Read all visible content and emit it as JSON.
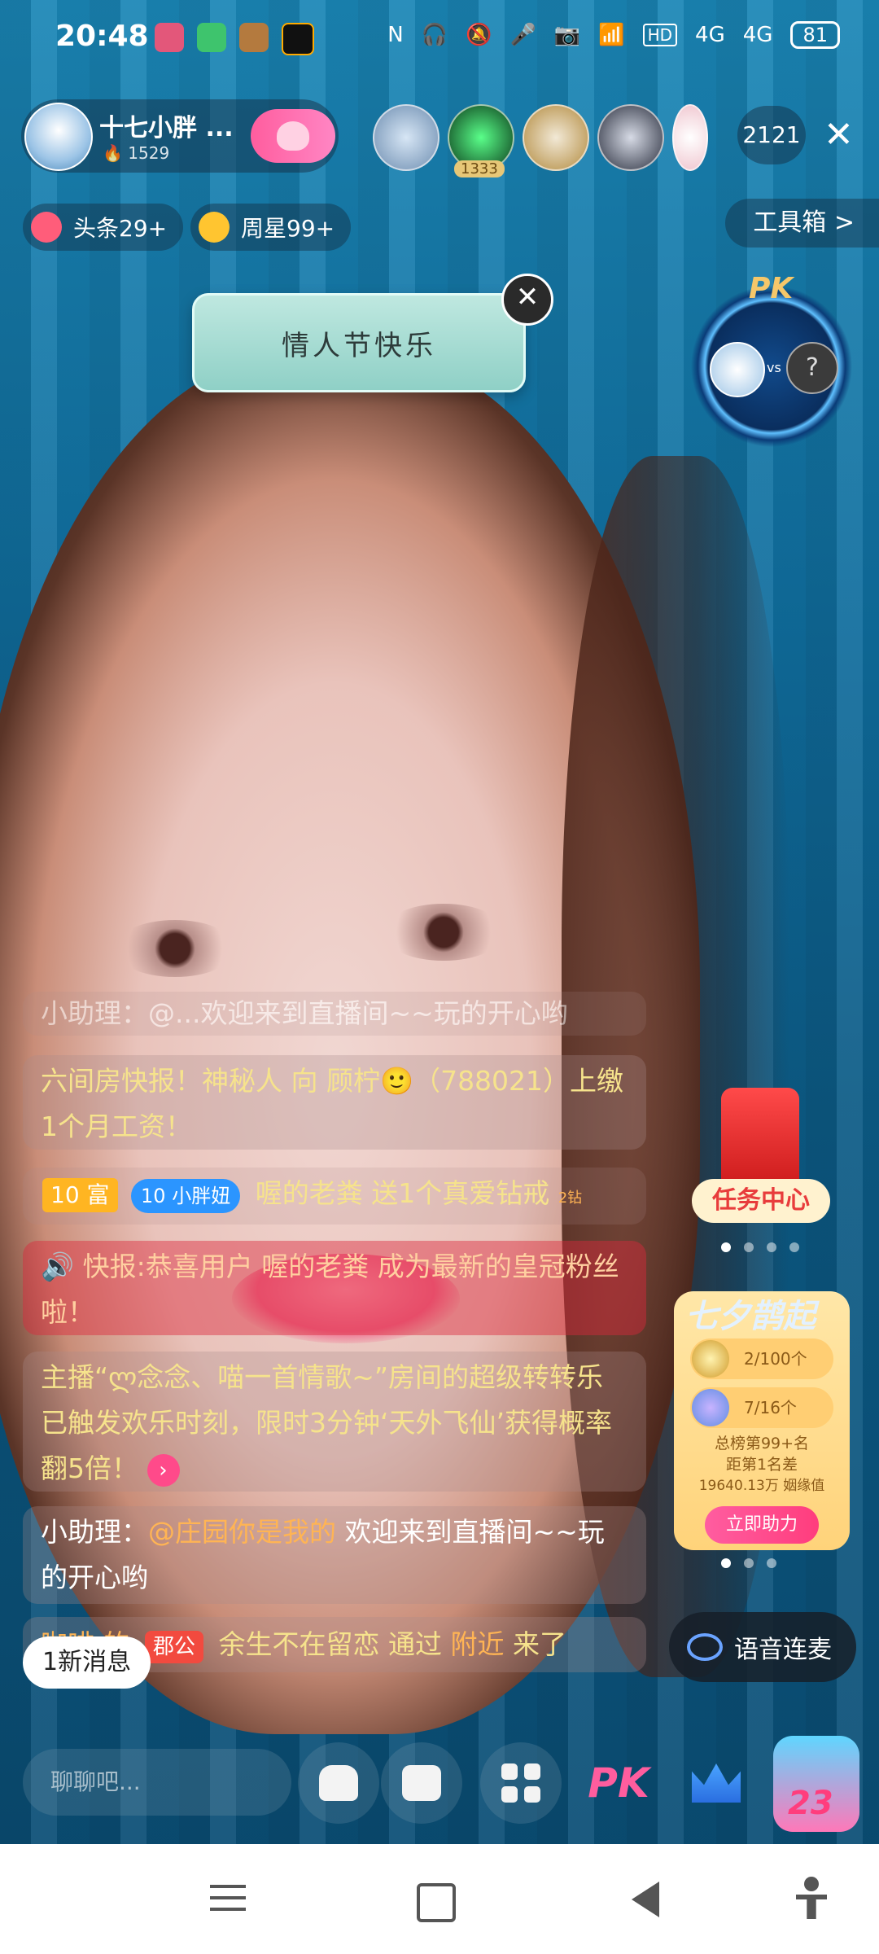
{
  "status_bar": {
    "time": "20:48",
    "network1": "4G",
    "network2": "4G",
    "hd_label": "HD",
    "battery": "81"
  },
  "anchor": {
    "name": "十七小胖 ...",
    "likes": "1529",
    "follow_icon": "heart-plus-icon"
  },
  "viewers": {
    "badge": "1333",
    "count": "2121"
  },
  "chips": {
    "headline": "头条29+",
    "weekly_star": "周星99+",
    "toolbox": "工具箱 >"
  },
  "banner": {
    "text": "情人节快乐"
  },
  "pk": {
    "label": "PK",
    "vs": "vs",
    "unknown": "?"
  },
  "chat": {
    "faded_line": "小助理：@...欢迎来到直播间~~玩的开心哟",
    "msg1": "六间房快报！神秘人 向 顾柠🙂（788021）上缴1个月工资！",
    "gift_level": "10 富",
    "gift_fan_level": "10",
    "gift_fan_name": "小胖妞",
    "gift_user": "喔的老粪",
    "gift_text": "送1个真爱钻戒",
    "gift_count": "2钻",
    "alert_prefix": "快报:",
    "alert_text": "恭喜用户 喔的老粪 成为最新的皇冠粉丝啦！",
    "host_line": "主播“ლ念念、喵一首情歌~”房间的超级转转乐已触发欢乐时刻，限时3分钟‘天外飞仙’获得概率翻5倍！",
    "helper_prefix": "小助理：",
    "helper_mention": "@庄园你是我的",
    "helper_text": "欢迎来到直播间~~玩的开心哟",
    "join_user": "咖啡 的",
    "join_badge": "郡公",
    "join_name": "余生不在留恋",
    "join_via": "通过",
    "join_source": "附近",
    "join_end": "来了"
  },
  "new_messages": "1新消息",
  "task_center": {
    "label": "任务中心"
  },
  "qixi": {
    "title": "七夕鹊起",
    "row1": "2/100个",
    "row2": "7/16个",
    "rank": "总榜第99+名",
    "gap": "距第1名差",
    "value": "19640.13万 姻缘值",
    "button": "立即助力"
  },
  "voice_button": "语音连麦",
  "bottom": {
    "input_placeholder": "聊聊吧...",
    "pk_label": "PK",
    "gift_number": "23"
  }
}
